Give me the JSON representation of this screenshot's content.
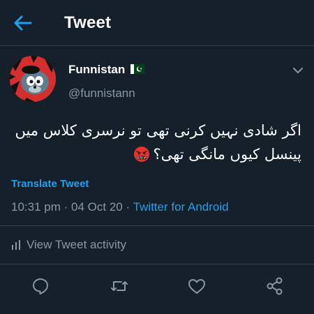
{
  "header": {
    "title": "Tweet",
    "back_icon": "arrow-left-icon"
  },
  "author": {
    "display_name": "Funnistan",
    "flag_icon": "pakistan-flag-icon",
    "handle": "@funnistann"
  },
  "tweet": {
    "text": "اگر شادی نہیں کرنی تھی تو نرسری کلاس میں پینسل کیوں مانگی تھی؟",
    "emoji_icon": "face-with-symbols-on-mouth-icon",
    "translate_label": "Translate Tweet",
    "time": "10:31 pm",
    "separator": "·",
    "date": "04 Oct 20",
    "source": "Twitter for Android"
  },
  "activity": {
    "label": "View Tweet activity"
  },
  "actions": [
    "reply-icon",
    "retweet-icon",
    "like-icon",
    "share-icon"
  ],
  "colors": {
    "background": "#15202b",
    "accent": "#1da1f2",
    "secondary_text": "#8899a6",
    "border": "#38444d"
  }
}
